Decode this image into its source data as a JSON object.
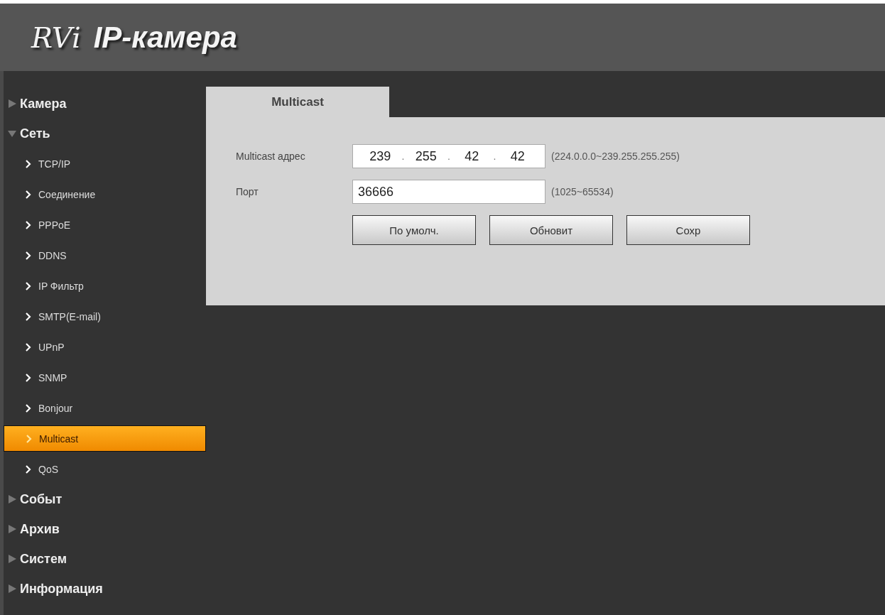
{
  "header": {
    "logo": "RVi",
    "title": "IP-камера"
  },
  "sidebar": {
    "items": [
      {
        "label": "Камера",
        "expanded": false
      },
      {
        "label": "Сеть",
        "expanded": true,
        "children": [
          {
            "label": "TCP/IP",
            "selected": false
          },
          {
            "label": "Соединение",
            "selected": false
          },
          {
            "label": "PPPoE",
            "selected": false
          },
          {
            "label": "DDNS",
            "selected": false
          },
          {
            "label": "IP Фильтр",
            "selected": false
          },
          {
            "label": "SMTP(E-mail)",
            "selected": false
          },
          {
            "label": "UPnP",
            "selected": false
          },
          {
            "label": "SNMP",
            "selected": false
          },
          {
            "label": "Bonjour",
            "selected": false
          },
          {
            "label": "Multicast",
            "selected": true
          },
          {
            "label": "QoS",
            "selected": false
          }
        ]
      },
      {
        "label": "Событ",
        "expanded": false
      },
      {
        "label": "Архив",
        "expanded": false
      },
      {
        "label": "Систем",
        "expanded": false
      },
      {
        "label": "Информация",
        "expanded": false
      }
    ]
  },
  "tabs": [
    {
      "label": "Multicast",
      "selected": true
    }
  ],
  "form": {
    "fields": [
      {
        "kind": "ip",
        "label": "Multicast адрес",
        "octets": [
          "239",
          "255",
          "42",
          "42"
        ],
        "separators": [
          ".",
          ".",
          "."
        ],
        "hint": "(224.0.0.0~239.255.255.255)"
      },
      {
        "kind": "text",
        "label": "Порт",
        "value": "36666",
        "hint": "(1025~65534)"
      }
    ],
    "buttons": [
      "По умолч.",
      "Обновит",
      "Сохр"
    ]
  }
}
